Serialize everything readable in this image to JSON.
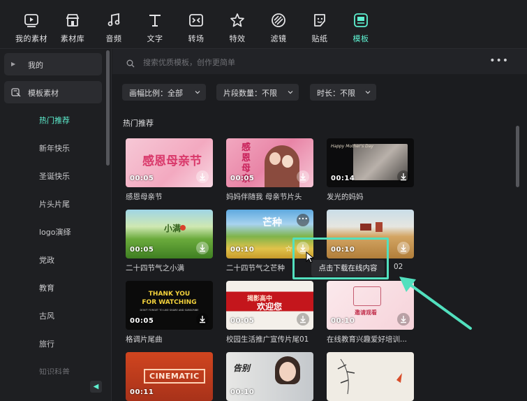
{
  "toolbar": {
    "items": [
      {
        "label": "我的素材",
        "icon": "my-media-icon",
        "active": false
      },
      {
        "label": "素材库",
        "icon": "stock-library-icon",
        "active": false
      },
      {
        "label": "音频",
        "icon": "audio-icon",
        "active": false
      },
      {
        "label": "文字",
        "icon": "text-icon",
        "active": false
      },
      {
        "label": "转场",
        "icon": "transition-icon",
        "active": false
      },
      {
        "label": "特效",
        "icon": "effects-icon",
        "active": false
      },
      {
        "label": "滤镜",
        "icon": "filter-icon",
        "active": false
      },
      {
        "label": "贴纸",
        "icon": "sticker-icon",
        "active": false
      },
      {
        "label": "模板",
        "icon": "template-icon",
        "active": true
      }
    ]
  },
  "sidebar": {
    "mine_label": "我的",
    "templates_label": "模板素材",
    "items": [
      {
        "label": "热门推荐",
        "active": true
      },
      {
        "label": "新年快乐",
        "active": false
      },
      {
        "label": "圣诞快乐",
        "active": false
      },
      {
        "label": "片头片尾",
        "active": false
      },
      {
        "label": "logo演绎",
        "active": false
      },
      {
        "label": "党政",
        "active": false
      },
      {
        "label": "教育",
        "active": false
      },
      {
        "label": "古风",
        "active": false
      },
      {
        "label": "旅行",
        "active": false
      },
      {
        "label": "知识科普",
        "active": false
      }
    ]
  },
  "search": {
    "placeholder": "搜索优质模板，创作更简单"
  },
  "filters": {
    "aspect_ratio": "画幅比例：全部",
    "clip_count": "片段数量：不限",
    "duration": "时长：不限"
  },
  "section_title": "热门推荐",
  "templates": [
    {
      "title": "感恩母亲节",
      "duration": "00:05"
    },
    {
      "title": "妈妈伴随我 母亲节片头",
      "duration": "00:05"
    },
    {
      "title": "发光的妈妈",
      "duration": "00:14"
    },
    {
      "title": "二十四节气之小满",
      "duration": "00:05"
    },
    {
      "title": "二十四节气之芒种",
      "duration": "00:10"
    },
    {
      "title": "02",
      "duration": "00:10"
    },
    {
      "title": "格调片尾曲",
      "duration": "00:05"
    },
    {
      "title": "校园生活推广宣传片尾01",
      "duration": "00:05"
    },
    {
      "title": "在线教育兴趣爱好培训...",
      "duration": "00:10"
    },
    {
      "title": "",
      "duration": "00:11"
    },
    {
      "title": "",
      "duration": "00:10"
    },
    {
      "title": "",
      "duration": ""
    }
  ],
  "thumb_text": {
    "mothers_day_1": "感恩母亲节",
    "mothers_day_2": "感恩母亲",
    "glowing_mom": "Happy Mother's Day",
    "xiaoman": "小满",
    "mangzhong": "芒种",
    "thank_you_1": "THANK YOU",
    "thank_you_2": "FOR WATCHING",
    "thank_you_3": "DON'T FORGET TO LIKE SHARE AND SUBSCRIBE",
    "campus_1": "揭影高中",
    "campus_2": "欢迎您",
    "edu": "邀请观看",
    "cinematic": "CINEMATIC",
    "vlog": "告别"
  },
  "tooltip": "点击下载在线内容",
  "colors": {
    "accent": "#5ef0d0",
    "annotation": "#52e0be",
    "background": "#1b1c1f"
  }
}
